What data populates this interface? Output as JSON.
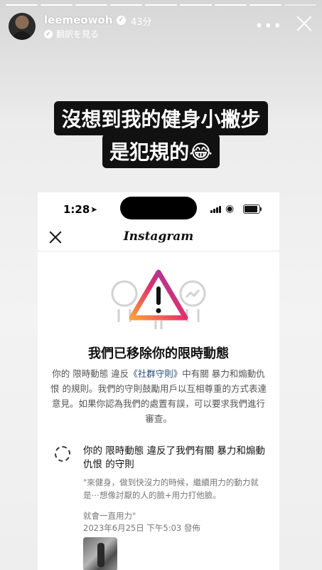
{
  "story": {
    "username": "leemeowoh",
    "time_ago": "43分",
    "translate_label": "翻訳を見る",
    "more_icon": "•••",
    "caption_line1": "沒想到我的健身小撇步",
    "caption_line2": "是犯規的😂"
  },
  "phone": {
    "status": {
      "time": "1:28",
      "location_icon": "➤",
      "wifi_icon": "◉"
    },
    "nav": {
      "logo_text": "Instagram"
    },
    "notice": {
      "headline": "我們已移除你的限時動態",
      "body_pre": "你的 限時動態 違反",
      "body_link": "《社群守則》",
      "body_post": "中有關 暴力和煽動仇恨 的規則。我們的守則鼓勵用戶以互相尊重的方式表達意見。如果你認為我們的處置有誤，可以要求我們進行審查。"
    },
    "story_item": {
      "title": "你的 限時動態 違反了我們有關 暴力和煽動仇恨 的守則",
      "quote": "\"來健身，做到快沒力的時候，繼續用力的動力就是⋯想像討厭的人的臉+用力打他臉。",
      "quote_end": "就會一直用力\"",
      "posted": "2023年6月25日 下午5:03 發佈"
    }
  },
  "colors": {
    "link": "#2b4a7a",
    "warning_gradient": [
      "#f9a33a",
      "#e1306c",
      "#833ab4"
    ]
  }
}
